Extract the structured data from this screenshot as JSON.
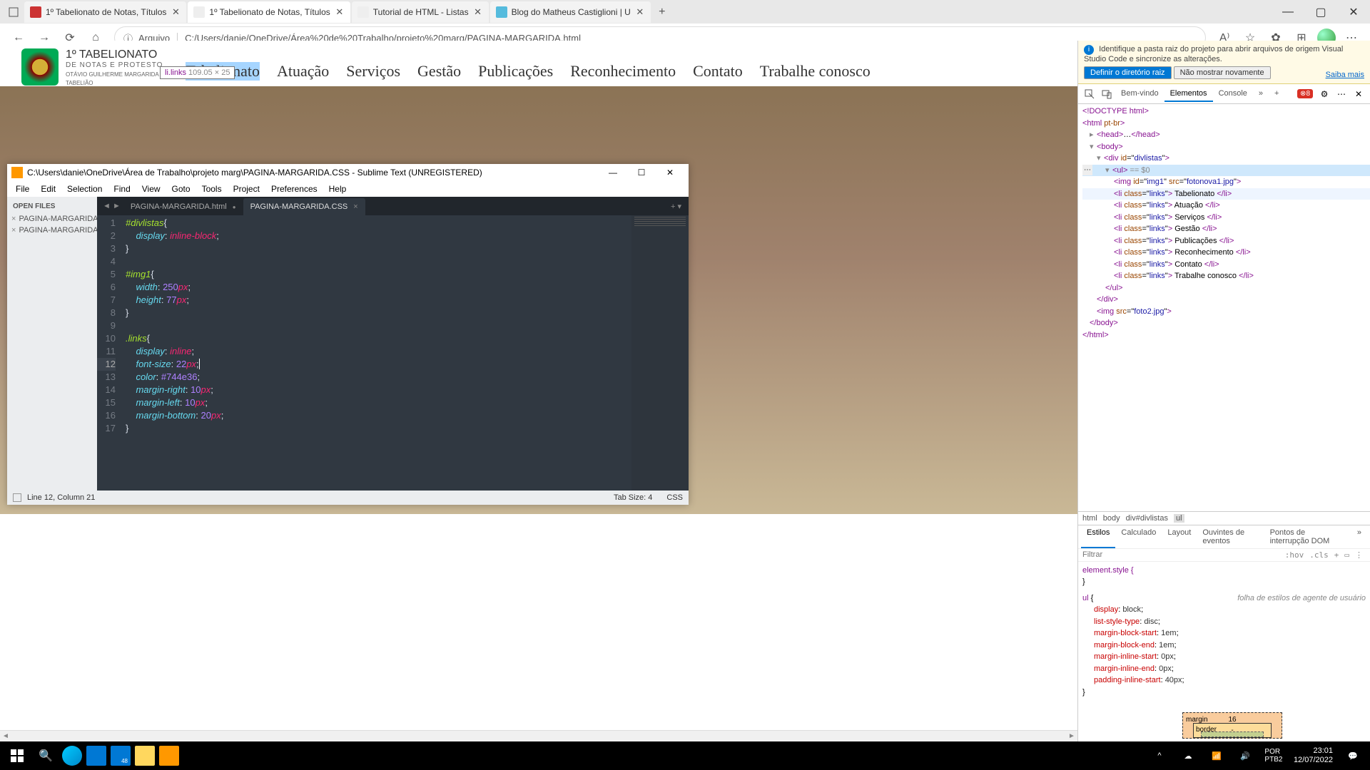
{
  "browser": {
    "tabs": [
      {
        "title": "1º Tabelionato de Notas, Títulos"
      },
      {
        "title": "1º Tabelionato de Notas, Títulos"
      },
      {
        "title": "Tutorial de HTML - Listas"
      },
      {
        "title": "Blog do Matheus Castiglioni | U"
      }
    ],
    "address_label": "Arquivo",
    "address": "C:/Users/danie/OneDrive/Área%20de%20Trabalho/projeto%20marg/PAGINA-MARGARIDA.html"
  },
  "inspect_tooltip": {
    "selector": "li.links",
    "dims": "109.05 × 25"
  },
  "site": {
    "logo": {
      "line1": "1º TABELIONATO",
      "line2": "DE NOTAS E PROTESTO",
      "line3": "OTÁVIO GUILHERME MARGARIDA",
      "line4": "TABELIÃO"
    },
    "nav": [
      "Tabelionato",
      "Atuação",
      "Serviços",
      "Gestão",
      "Publicações",
      "Reconhecimento",
      "Contato",
      "Trabalhe conosco"
    ]
  },
  "devtools": {
    "banner_text": "Identifique a pasta raiz do projeto para abrir arquivos de origem Visual Studio Code e sincronize as alterações.",
    "banner_link": "Saiba mais",
    "banner_btn1": "Definir o diretório raiz",
    "banner_btn2": "Não mostrar novamente",
    "tabs": {
      "welcome": "Bem-vindo",
      "elements": "Elementos",
      "console": "Console"
    },
    "error_count": "8",
    "selected_eq": "== $0",
    "dom_links": [
      "Tabelionato",
      "Atuação",
      "Serviços",
      "Gestão",
      "Publicações",
      "Reconhecimento",
      "Contato",
      "Trabalhe conosco"
    ],
    "crumbs": [
      "html",
      "body",
      "div#divlistas",
      "ul"
    ],
    "styles_tabs": [
      "Estilos",
      "Calculado",
      "Layout",
      "Ouvintes de eventos",
      "Pontos de interrupção DOM"
    ],
    "filter_placeholder": "Filtrar",
    "hov": ":hov",
    "cls": ".cls",
    "element_style": "element.style {",
    "ua_label": "folha de estilos de agente de usuário",
    "ul_rules": [
      {
        "p": "display",
        "v": "block"
      },
      {
        "p": "list-style-type",
        "v": "disc"
      },
      {
        "p": "margin-block-start",
        "v": "1em"
      },
      {
        "p": "margin-block-end",
        "v": "1em"
      },
      {
        "p": "margin-inline-start",
        "v": "0px"
      },
      {
        "p": "margin-inline-end",
        "v": "0px"
      },
      {
        "p": "padding-inline-start",
        "v": "40px"
      }
    ],
    "box_margin_top": "16",
    "box_border_top": "-"
  },
  "sublime": {
    "title": "C:\\Users\\danie\\OneDrive\\Área de Trabalho\\projeto marg\\PAGINA-MARGARIDA.CSS - Sublime Text (UNREGISTERED)",
    "menu": [
      "File",
      "Edit",
      "Selection",
      "Find",
      "View",
      "Goto",
      "Tools",
      "Project",
      "Preferences",
      "Help"
    ],
    "sidebar_header": "OPEN FILES",
    "sidebar_files": [
      "PAGINA-MARGARIDA.h",
      "PAGINA-MARGARIDA.C"
    ],
    "tabs": [
      "PAGINA-MARGARIDA.html",
      "PAGINA-MARGARIDA.CSS"
    ],
    "status_left": "Line 12, Column 21",
    "status_tab": "Tab Size: 4",
    "status_lang": "CSS"
  },
  "taskbar": {
    "mail_badge": "48",
    "time": "23:01",
    "date": "12/07/2022"
  }
}
